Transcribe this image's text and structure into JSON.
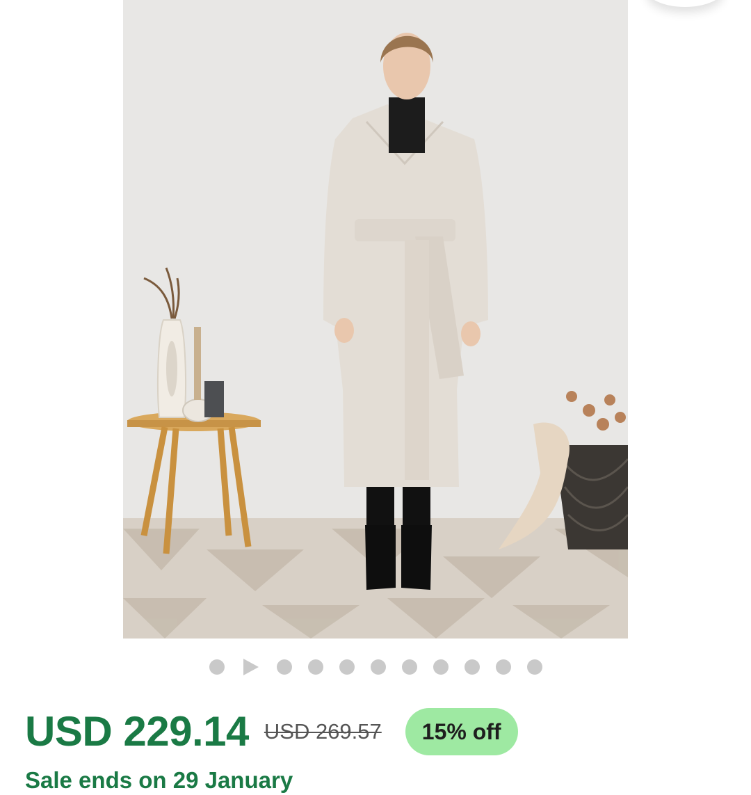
{
  "product": {
    "image_alt": "Model wearing a long beige wrap coat with belt",
    "carousel": {
      "slides": [
        "dot",
        "play",
        "dot",
        "dot",
        "dot",
        "dot",
        "dot",
        "dot",
        "dot",
        "dot",
        "dot"
      ],
      "active_index": 0
    },
    "price": "USD 229.14",
    "original_price": "USD 269.57",
    "discount_badge": "15% off",
    "sale_note": "Sale ends on 29 January"
  },
  "colors": {
    "price_green": "#1a7a45",
    "badge_green": "#9ee9a2",
    "dot_grey": "#c9c9c9"
  }
}
